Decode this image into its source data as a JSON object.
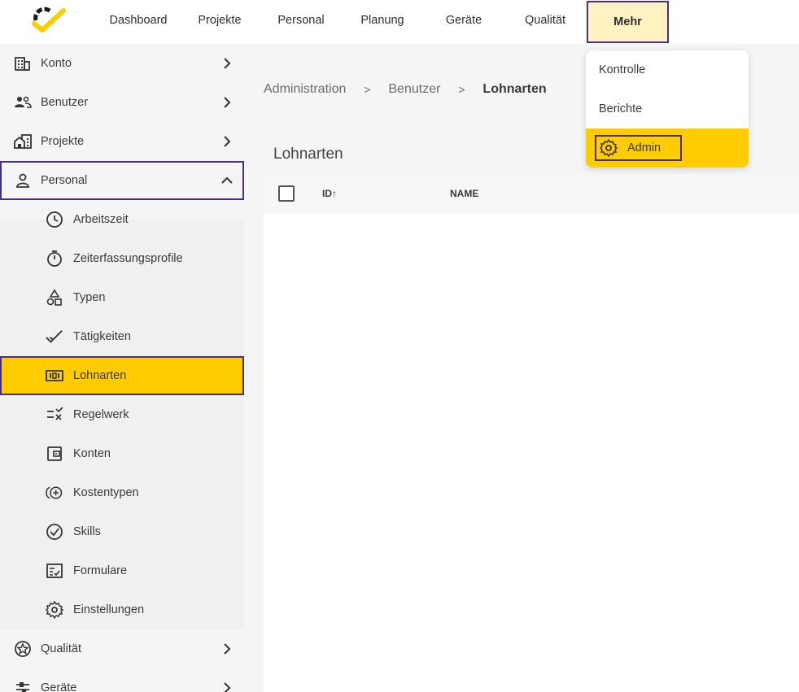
{
  "topnav": {
    "items": [
      "Dashboard",
      "Projekte",
      "Personal",
      "Planung",
      "Geräte",
      "Qualität"
    ],
    "more_label": "Mehr"
  },
  "dropdown": {
    "items": [
      "Kontrolle",
      "Berichte"
    ],
    "admin_label": "Admin"
  },
  "sidebar": {
    "konto": "Konto",
    "benutzer": "Benutzer",
    "projekte": "Projekte",
    "personal": "Personal",
    "sub_items": [
      "Arbeitszeit",
      "Zeiterfassungsprofile",
      "Typen",
      "Tätigkeiten",
      "Lohnarten",
      "Regelwerk",
      "Konten",
      "Kostentypen",
      "Skills",
      "Formulare",
      "Einstellungen"
    ],
    "qualitaet": "Qualität",
    "geraete": "Geräte"
  },
  "breadcrumb": {
    "items": [
      "Administration",
      "Benutzer",
      "Lohnarten"
    ],
    "separator": ">"
  },
  "page": {
    "title": "Lohnarten"
  },
  "table": {
    "col_id": "ID↑",
    "col_name": "NAME"
  },
  "colors": {
    "accent": "#ffcc00",
    "outline": "#4a2d86",
    "highlight_light": "#fff2c2"
  }
}
